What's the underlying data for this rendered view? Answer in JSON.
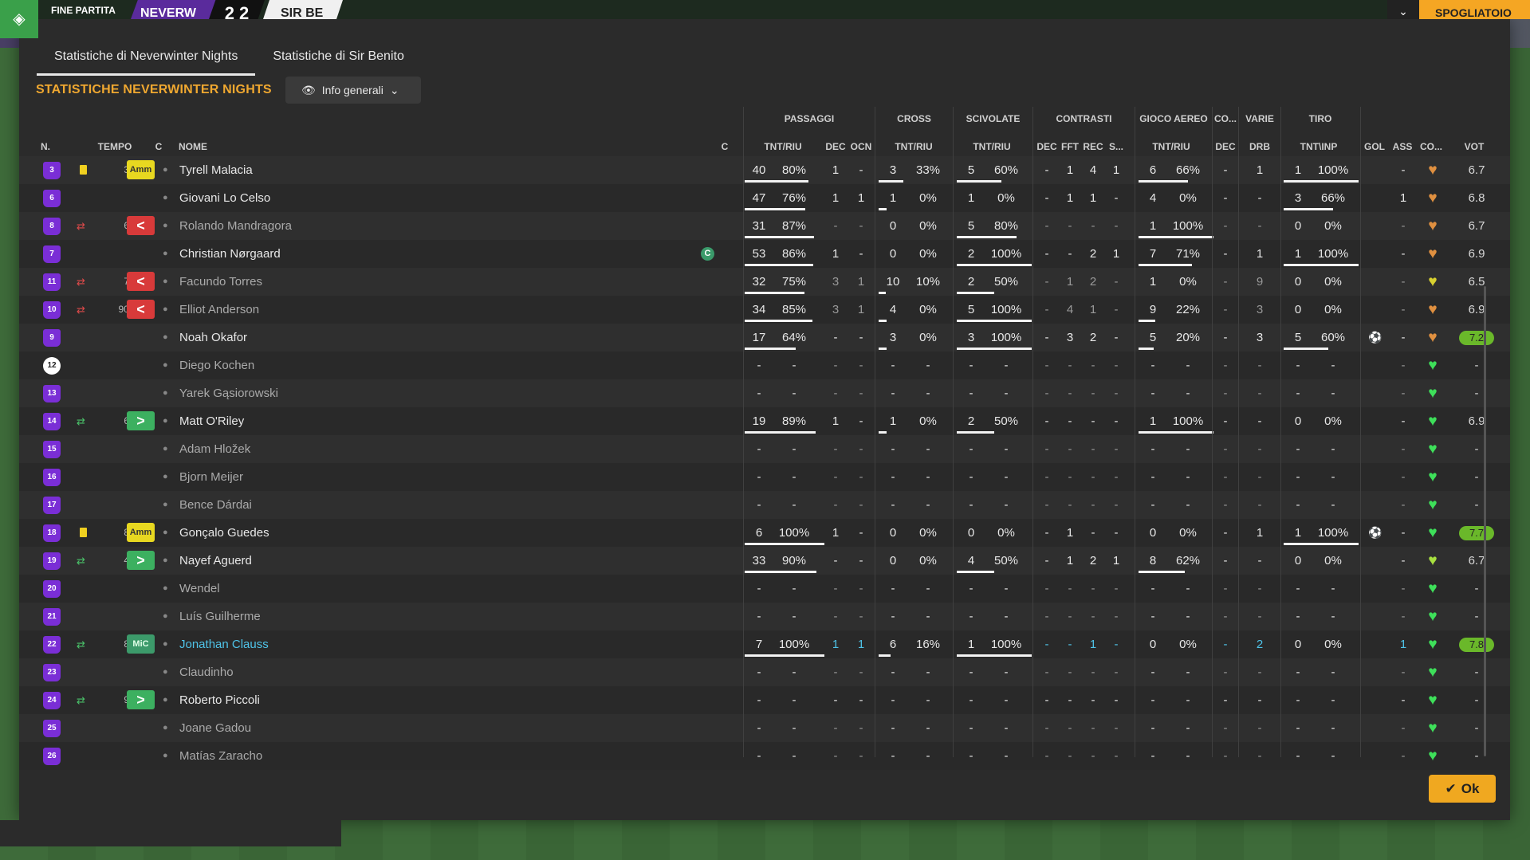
{
  "topbar": {
    "status": "FINE PARTITA",
    "team_a": "NEVERW",
    "score": "2  2",
    "team_b": "SIR BE",
    "dressing_room": "SPOGLIATOIO"
  },
  "tabs": [
    "Statistiche di Neverwinter Nights",
    "Statistiche di Sir Benito"
  ],
  "section_title": "STATISTICHE NEVERWINTER NIGHTS",
  "view_button": "Info generali",
  "ok_button": "Ok",
  "groups": [
    {
      "label": "PASSAGGI"
    },
    {
      "label": "CROSS"
    },
    {
      "label": "SCIVOLATE"
    },
    {
      "label": "CONTRASTI"
    },
    {
      "label": "GIOCO AEREO"
    },
    {
      "label": "CO..."
    },
    {
      "label": "VARIE"
    },
    {
      "label": "TIRO"
    }
  ],
  "columns": {
    "n": "N.",
    "tempo": "TEMPO",
    "c": "C",
    "nome": "NOME",
    "c2": "C",
    "pass_tnt": "TNT/RIU",
    "pass_dec": "DEC",
    "pass_ocn": "OCN",
    "cross_tnt": "TNT/RIU",
    "sciv_tnt": "TNT/RIU",
    "con_dec": "DEC",
    "con_fft": "FFT",
    "con_rec": "REC",
    "con_s": "S...",
    "aereo_tnt": "TNT/RIU",
    "co_dec": "DEC",
    "varie_drb": "DRB",
    "tiro_tnt": "TNT\\INP",
    "gol": "GOL",
    "ass": "ASS",
    "co": "CO...",
    "vot": "VOT"
  },
  "players": [
    {
      "n": "3",
      "card": "yellow",
      "sub": "",
      "minute": "35",
      "badge": "Amm",
      "badge_type": "amm",
      "name": "Tyrell Malacia",
      "captain": "",
      "style": "",
      "p": [
        "40",
        "80%"
      ],
      "pbar": 0.8,
      "dec": "1",
      "ocn": "-",
      "cr": [
        "3",
        "33%"
      ],
      "crbar": 0.33,
      "sc": [
        "5",
        "60%"
      ],
      "scbar": 0.6,
      "cd": "-",
      "cf": "1",
      "crc": "4",
      "cs": "1",
      "ae": [
        "6",
        "66%"
      ],
      "aebar": 0.66,
      "co": "-",
      "drb": "1",
      "ti": [
        "1",
        "100%"
      ],
      "tibar": 1,
      "gol": "",
      "ass": "-",
      "heart": "orange",
      "vot": "6.7",
      "vot_hi": false
    },
    {
      "n": "6",
      "card": "",
      "sub": "",
      "minute": "",
      "badge": "",
      "badge_type": "",
      "name": "Giovani Lo Celso",
      "captain": "",
      "style": "",
      "p": [
        "47",
        "76%"
      ],
      "pbar": 0.76,
      "dec": "1",
      "ocn": "1",
      "cr": [
        "1",
        "0%"
      ],
      "crbar": 0,
      "sc": [
        "1",
        "0%"
      ],
      "scbar": 0,
      "cd": "-",
      "cf": "1",
      "crc": "1",
      "cs": "-",
      "ae": [
        "4",
        "0%"
      ],
      "aebar": 0,
      "co": "-",
      "drb": "-",
      "ti": [
        "3",
        "66%"
      ],
      "tibar": 0.66,
      "gol": "",
      "ass": "1",
      "heart": "orange",
      "vot": "6.8",
      "vot_hi": false
    },
    {
      "n": "8",
      "card": "",
      "sub": "out",
      "minute": "60",
      "badge": "<",
      "badge_type": "out",
      "name": "Rolando Mandragora",
      "captain": "",
      "style": "dim",
      "p": [
        "31",
        "87%"
      ],
      "pbar": 0.87,
      "dec": "-",
      "ocn": "-",
      "cr": [
        "0",
        "0%"
      ],
      "crbar": 0,
      "sc": [
        "5",
        "80%"
      ],
      "scbar": 0.8,
      "cd": "-",
      "cf": "-",
      "crc": "-",
      "cs": "-",
      "ae": [
        "1",
        "100%"
      ],
      "aebar": 1,
      "co": "-",
      "drb": "-",
      "ti": [
        "0",
        "0%"
      ],
      "tibar": 0,
      "gol": "",
      "ass": "-",
      "heart": "orange",
      "vot": "6.7",
      "vot_hi": false
    },
    {
      "n": "7",
      "card": "",
      "sub": "",
      "minute": "",
      "badge": "",
      "badge_type": "",
      "name": "Christian Nørgaard",
      "captain": "C",
      "style": "",
      "p": [
        "53",
        "86%"
      ],
      "pbar": 0.86,
      "dec": "1",
      "ocn": "-",
      "cr": [
        "0",
        "0%"
      ],
      "crbar": 0,
      "sc": [
        "2",
        "100%"
      ],
      "scbar": 1,
      "cd": "-",
      "cf": "-",
      "crc": "2",
      "cs": "1",
      "ae": [
        "7",
        "71%"
      ],
      "aebar": 0.71,
      "co": "-",
      "drb": "1",
      "ti": [
        "1",
        "100%"
      ],
      "tibar": 1,
      "gol": "",
      "ass": "-",
      "heart": "orange",
      "vot": "6.9",
      "vot_hi": false
    },
    {
      "n": "11",
      "card": "",
      "sub": "out",
      "minute": "70",
      "badge": "<",
      "badge_type": "out",
      "name": "Facundo Torres",
      "captain": "",
      "style": "dim",
      "p": [
        "32",
        "75%"
      ],
      "pbar": 0.75,
      "dec": "3",
      "ocn": "1",
      "cr": [
        "10",
        "10%"
      ],
      "crbar": 0.1,
      "sc": [
        "2",
        "50%"
      ],
      "scbar": 0.5,
      "cd": "-",
      "cf": "1",
      "crc": "2",
      "cs": "-",
      "ae": [
        "1",
        "0%"
      ],
      "aebar": 0,
      "co": "-",
      "drb": "9",
      "ti": [
        "0",
        "0%"
      ],
      "tibar": 0,
      "gol": "",
      "ass": "-",
      "heart": "yellow",
      "vot": "6.5",
      "vot_hi": false
    },
    {
      "n": "10",
      "card": "",
      "sub": "out",
      "minute": "90+6",
      "badge": "<",
      "badge_type": "out",
      "name": "Elliot Anderson",
      "captain": "",
      "style": "dim",
      "p": [
        "34",
        "85%"
      ],
      "pbar": 0.85,
      "dec": "3",
      "ocn": "1",
      "cr": [
        "4",
        "0%"
      ],
      "crbar": 0,
      "sc": [
        "5",
        "100%"
      ],
      "scbar": 1,
      "cd": "-",
      "cf": "4",
      "crc": "1",
      "cs": "-",
      "ae": [
        "9",
        "22%"
      ],
      "aebar": 0.22,
      "co": "-",
      "drb": "3",
      "ti": [
        "0",
        "0%"
      ],
      "tibar": 0,
      "gol": "",
      "ass": "-",
      "heart": "orange",
      "vot": "6.9",
      "vot_hi": false
    },
    {
      "n": "9",
      "card": "",
      "sub": "",
      "minute": "",
      "badge": "",
      "badge_type": "",
      "name": "Noah Okafor",
      "captain": "",
      "style": "",
      "p": [
        "17",
        "64%"
      ],
      "pbar": 0.64,
      "dec": "-",
      "ocn": "-",
      "cr": [
        "3",
        "0%"
      ],
      "crbar": 0,
      "sc": [
        "3",
        "100%"
      ],
      "scbar": 1,
      "cd": "-",
      "cf": "3",
      "crc": "2",
      "cs": "-",
      "ae": [
        "5",
        "20%"
      ],
      "aebar": 0.2,
      "co": "-",
      "drb": "3",
      "ti": [
        "5",
        "60%"
      ],
      "tibar": 0.6,
      "gol": "⚽",
      "ass": "-",
      "heart": "orange",
      "vot": "7.2",
      "vot_hi": true
    },
    {
      "n": "12",
      "card": "",
      "sub": "",
      "minute": "",
      "badge": "",
      "badge_type": "",
      "name": "Diego Kochen",
      "captain": "",
      "style": "dim",
      "gk": true,
      "p": [
        "-",
        "-"
      ],
      "pbar": -1,
      "dec": "-",
      "ocn": "-",
      "cr": [
        "-",
        "-"
      ],
      "crbar": -1,
      "sc": [
        "-",
        "-"
      ],
      "scbar": -1,
      "cd": "-",
      "cf": "-",
      "crc": "-",
      "cs": "-",
      "ae": [
        "-",
        "-"
      ],
      "aebar": -1,
      "co": "-",
      "drb": "-",
      "ti": [
        "-",
        "-"
      ],
      "tibar": -1,
      "gol": "",
      "ass": "-",
      "heart": "green",
      "vot": "-",
      "vot_hi": false
    },
    {
      "n": "13",
      "card": "",
      "sub": "",
      "minute": "",
      "badge": "",
      "badge_type": "",
      "name": "Yarek Gąsiorowski",
      "captain": "",
      "style": "dim",
      "p": [
        "-",
        "-"
      ],
      "pbar": -1,
      "dec": "-",
      "ocn": "-",
      "cr": [
        "-",
        "-"
      ],
      "crbar": -1,
      "sc": [
        "-",
        "-"
      ],
      "scbar": -1,
      "cd": "-",
      "cf": "-",
      "crc": "-",
      "cs": "-",
      "ae": [
        "-",
        "-"
      ],
      "aebar": -1,
      "co": "-",
      "drb": "-",
      "ti": [
        "-",
        "-"
      ],
      "tibar": -1,
      "gol": "",
      "ass": "-",
      "heart": "green",
      "vot": "-",
      "vot_hi": false
    },
    {
      "n": "14",
      "card": "",
      "sub": "in",
      "minute": "60",
      "badge": ">",
      "badge_type": "in",
      "name": "Matt O'Riley",
      "captain": "",
      "style": "",
      "p": [
        "19",
        "89%"
      ],
      "pbar": 0.89,
      "dec": "1",
      "ocn": "-",
      "cr": [
        "1",
        "0%"
      ],
      "crbar": 0,
      "sc": [
        "2",
        "50%"
      ],
      "scbar": 0.5,
      "cd": "-",
      "cf": "-",
      "crc": "-",
      "cs": "-",
      "ae": [
        "1",
        "100%"
      ],
      "aebar": 1,
      "co": "-",
      "drb": "-",
      "ti": [
        "0",
        "0%"
      ],
      "tibar": 0,
      "gol": "",
      "ass": "-",
      "heart": "green",
      "vot": "6.9",
      "vot_hi": false
    },
    {
      "n": "15",
      "card": "",
      "sub": "",
      "minute": "",
      "badge": "",
      "badge_type": "",
      "name": "Adam Hložek",
      "captain": "",
      "style": "dim",
      "p": [
        "-",
        "-"
      ],
      "pbar": -1,
      "dec": "-",
      "ocn": "-",
      "cr": [
        "-",
        "-"
      ],
      "crbar": -1,
      "sc": [
        "-",
        "-"
      ],
      "scbar": -1,
      "cd": "-",
      "cf": "-",
      "crc": "-",
      "cs": "-",
      "ae": [
        "-",
        "-"
      ],
      "aebar": -1,
      "co": "-",
      "drb": "-",
      "ti": [
        "-",
        "-"
      ],
      "tibar": -1,
      "gol": "",
      "ass": "-",
      "heart": "green",
      "vot": "-",
      "vot_hi": false
    },
    {
      "n": "16",
      "card": "",
      "sub": "",
      "minute": "",
      "badge": "",
      "badge_type": "",
      "name": "Bjorn Meijer",
      "captain": "",
      "style": "dim",
      "p": [
        "-",
        "-"
      ],
      "pbar": -1,
      "dec": "-",
      "ocn": "-",
      "cr": [
        "-",
        "-"
      ],
      "crbar": -1,
      "sc": [
        "-",
        "-"
      ],
      "scbar": -1,
      "cd": "-",
      "cf": "-",
      "crc": "-",
      "cs": "-",
      "ae": [
        "-",
        "-"
      ],
      "aebar": -1,
      "co": "-",
      "drb": "-",
      "ti": [
        "-",
        "-"
      ],
      "tibar": -1,
      "gol": "",
      "ass": "-",
      "heart": "green",
      "vot": "-",
      "vot_hi": false
    },
    {
      "n": "17",
      "card": "",
      "sub": "",
      "minute": "",
      "badge": "",
      "badge_type": "",
      "name": "Bence Dárdai",
      "captain": "",
      "style": "dim",
      "p": [
        "-",
        "-"
      ],
      "pbar": -1,
      "dec": "-",
      "ocn": "-",
      "cr": [
        "-",
        "-"
      ],
      "crbar": -1,
      "sc": [
        "-",
        "-"
      ],
      "scbar": -1,
      "cd": "-",
      "cf": "-",
      "crc": "-",
      "cs": "-",
      "ae": [
        "-",
        "-"
      ],
      "aebar": -1,
      "co": "-",
      "drb": "-",
      "ti": [
        "-",
        "-"
      ],
      "tibar": -1,
      "gol": "",
      "ass": "-",
      "heart": "green",
      "vot": "-",
      "vot_hi": false
    },
    {
      "n": "18",
      "card": "yellow",
      "sub": "",
      "minute": "81",
      "badge": "Amm",
      "badge_type": "amm",
      "name": "Gonçalo Guedes",
      "captain": "",
      "style": "",
      "p": [
        "6",
        "100%"
      ],
      "pbar": 1,
      "dec": "1",
      "ocn": "-",
      "cr": [
        "0",
        "0%"
      ],
      "crbar": 0,
      "sc": [
        "0",
        "0%"
      ],
      "scbar": 0,
      "cd": "-",
      "cf": "1",
      "crc": "-",
      "cs": "-",
      "ae": [
        "0",
        "0%"
      ],
      "aebar": 0,
      "co": "-",
      "drb": "1",
      "ti": [
        "1",
        "100%"
      ],
      "tibar": 1,
      "gol": "⚽",
      "ass": "-",
      "heart": "green",
      "vot": "7.7",
      "vot_hi": true
    },
    {
      "n": "19",
      "card": "",
      "sub": "in",
      "minute": "45",
      "badge": ">",
      "badge_type": "in",
      "name": "Nayef Aguerd",
      "captain": "",
      "style": "",
      "p": [
        "33",
        "90%"
      ],
      "pbar": 0.9,
      "dec": "-",
      "ocn": "-",
      "cr": [
        "0",
        "0%"
      ],
      "crbar": 0,
      "sc": [
        "4",
        "50%"
      ],
      "scbar": 0.5,
      "cd": "-",
      "cf": "1",
      "crc": "2",
      "cs": "1",
      "ae": [
        "8",
        "62%"
      ],
      "aebar": 0.62,
      "co": "-",
      "drb": "-",
      "ti": [
        "0",
        "0%"
      ],
      "tibar": 0,
      "gol": "",
      "ass": "-",
      "heart": "lime",
      "vot": "6.7",
      "vot_hi": false
    },
    {
      "n": "20",
      "card": "",
      "sub": "",
      "minute": "",
      "badge": "",
      "badge_type": "",
      "name": "Wendel",
      "captain": "",
      "style": "dim",
      "p": [
        "-",
        "-"
      ],
      "pbar": -1,
      "dec": "-",
      "ocn": "-",
      "cr": [
        "-",
        "-"
      ],
      "crbar": -1,
      "sc": [
        "-",
        "-"
      ],
      "scbar": -1,
      "cd": "-",
      "cf": "-",
      "crc": "-",
      "cs": "-",
      "ae": [
        "-",
        "-"
      ],
      "aebar": -1,
      "co": "-",
      "drb": "-",
      "ti": [
        "-",
        "-"
      ],
      "tibar": -1,
      "gol": "",
      "ass": "-",
      "heart": "green",
      "vot": "-",
      "vot_hi": false
    },
    {
      "n": "21",
      "card": "",
      "sub": "",
      "minute": "",
      "badge": "",
      "badge_type": "",
      "name": "Luís Guilherme",
      "captain": "",
      "style": "dim",
      "p": [
        "-",
        "-"
      ],
      "pbar": -1,
      "dec": "-",
      "ocn": "-",
      "cr": [
        "-",
        "-"
      ],
      "crbar": -1,
      "sc": [
        "-",
        "-"
      ],
      "scbar": -1,
      "cd": "-",
      "cf": "-",
      "crc": "-",
      "cs": "-",
      "ae": [
        "-",
        "-"
      ],
      "aebar": -1,
      "co": "-",
      "drb": "-",
      "ti": [
        "-",
        "-"
      ],
      "tibar": -1,
      "gol": "",
      "ass": "-",
      "heart": "green",
      "vot": "-",
      "vot_hi": false
    },
    {
      "n": "22",
      "card": "",
      "sub": "in",
      "minute": "80",
      "badge": "MiC",
      "badge_type": "mic",
      "name": "Jonathan Clauss",
      "captain": "",
      "style": "blue",
      "p": [
        "7",
        "100%"
      ],
      "pbar": 1,
      "dec": "1",
      "ocn": "1",
      "cr": [
        "6",
        "16%"
      ],
      "crbar": 0.16,
      "sc": [
        "1",
        "100%"
      ],
      "scbar": 1,
      "cd": "-",
      "cf": "-",
      "crc": "1",
      "cs": "-",
      "ae": [
        "0",
        "0%"
      ],
      "aebar": 0,
      "co": "-",
      "drb": "2",
      "ti": [
        "0",
        "0%"
      ],
      "tibar": 0,
      "gol": "",
      "ass": "1",
      "heart": "green",
      "vot": "7.8",
      "vot_hi": true
    },
    {
      "n": "23",
      "card": "",
      "sub": "",
      "minute": "",
      "badge": "",
      "badge_type": "",
      "name": "Claudinho",
      "captain": "",
      "style": "dim",
      "p": [
        "-",
        "-"
      ],
      "pbar": -1,
      "dec": "-",
      "ocn": "-",
      "cr": [
        "-",
        "-"
      ],
      "crbar": -1,
      "sc": [
        "-",
        "-"
      ],
      "scbar": -1,
      "cd": "-",
      "cf": "-",
      "crc": "-",
      "cs": "-",
      "ae": [
        "-",
        "-"
      ],
      "aebar": -1,
      "co": "-",
      "drb": "-",
      "ti": [
        "-",
        "-"
      ],
      "tibar": -1,
      "gol": "",
      "ass": "-",
      "heart": "green",
      "vot": "-",
      "vot_hi": false
    },
    {
      "n": "24",
      "card": "",
      "sub": "in",
      "minute": "90",
      "badge": ">",
      "badge_type": "in",
      "name": "Roberto Piccoli",
      "captain": "",
      "style": "",
      "p": [
        "-",
        "-"
      ],
      "pbar": -1,
      "dec": "-",
      "ocn": "-",
      "cr": [
        "-",
        "-"
      ],
      "crbar": -1,
      "sc": [
        "-",
        "-"
      ],
      "scbar": -1,
      "cd": "-",
      "cf": "-",
      "crc": "-",
      "cs": "-",
      "ae": [
        "-",
        "-"
      ],
      "aebar": -1,
      "co": "-",
      "drb": "-",
      "ti": [
        "-",
        "-"
      ],
      "tibar": -1,
      "gol": "",
      "ass": "-",
      "heart": "green",
      "vot": "-",
      "vot_hi": false
    },
    {
      "n": "25",
      "card": "",
      "sub": "",
      "minute": "",
      "badge": "",
      "badge_type": "",
      "name": "Joane Gadou",
      "captain": "",
      "style": "dim",
      "p": [
        "-",
        "-"
      ],
      "pbar": -1,
      "dec": "-",
      "ocn": "-",
      "cr": [
        "-",
        "-"
      ],
      "crbar": -1,
      "sc": [
        "-",
        "-"
      ],
      "scbar": -1,
      "cd": "-",
      "cf": "-",
      "crc": "-",
      "cs": "-",
      "ae": [
        "-",
        "-"
      ],
      "aebar": -1,
      "co": "-",
      "drb": "-",
      "ti": [
        "-",
        "-"
      ],
      "tibar": -1,
      "gol": "",
      "ass": "-",
      "heart": "green",
      "vot": "-",
      "vot_hi": false
    },
    {
      "n": "26",
      "card": "",
      "sub": "",
      "minute": "",
      "badge": "",
      "badge_type": "",
      "name": "Matías Zaracho",
      "captain": "",
      "style": "dim",
      "p": [
        "-",
        "-"
      ],
      "pbar": -1,
      "dec": "-",
      "ocn": "-",
      "cr": [
        "-",
        "-"
      ],
      "crbar": -1,
      "sc": [
        "-",
        "-"
      ],
      "scbar": -1,
      "cd": "-",
      "cf": "-",
      "crc": "-",
      "cs": "-",
      "ae": [
        "-",
        "-"
      ],
      "aebar": -1,
      "co": "-",
      "drb": "-",
      "ti": [
        "-",
        "-"
      ],
      "tibar": -1,
      "gol": "",
      "ass": "-",
      "heart": "green",
      "vot": "-",
      "vot_hi": false
    }
  ],
  "colors": {
    "accent": "#f0a830",
    "heart_orange": "#e09040",
    "heart_yellow": "#d8d030",
    "heart_lime": "#a8e040",
    "heart_green": "#3ee05a"
  }
}
